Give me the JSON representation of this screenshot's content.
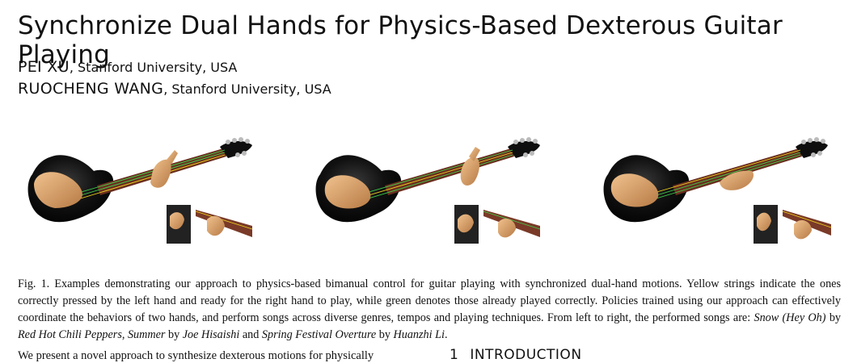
{
  "paper": {
    "title": "Synchronize Dual Hands for Physics-Based Dexterous Guitar Playing",
    "authors": [
      {
        "name": "PEI XU",
        "affiliation": ", Stanford University, USA"
      },
      {
        "name": "RUOCHENG WANG",
        "affiliation": ", Stanford University, USA"
      }
    ]
  },
  "figure": {
    "caption_parts": {
      "label": "Fig. 1.",
      "text": "Examples demonstrating our approach to physics-based bimanual control for guitar playing with synchronized dual-hand motions. Yellow strings indicate the ones correctly pressed by the left hand and ready for the right hand to play, while green denotes those already played correctly. Policies trained using our approach can effectively coordinate the behaviors of two hands, and perform songs across diverse genres, tempos and playing techniques. From left to right, the performed songs are: ",
      "song1": "Snow (Hey Oh)",
      "by1": " by ",
      "artist1": "Red Hot Chili Peppers",
      "sep1": ", ",
      "song2": "Summer",
      "by2": " by ",
      "artist2": "Joe Hisaishi",
      "and": " and ",
      "song3": "Spring Festival Overture",
      "by3": " by ",
      "artist3": "Huanzhi Li",
      "end": "."
    }
  },
  "body": {
    "abstract_start": "We present a novel approach to synthesize dexterous motions for physically",
    "section_number": "1",
    "section_title": "INTRODUCTION"
  },
  "colors": {
    "guitar_body": "#0d0d0d",
    "neck": "#6b2f20",
    "string_played": "#3fd24a",
    "string_pressed": "#f2d21b",
    "hand": "#d9a06a"
  }
}
